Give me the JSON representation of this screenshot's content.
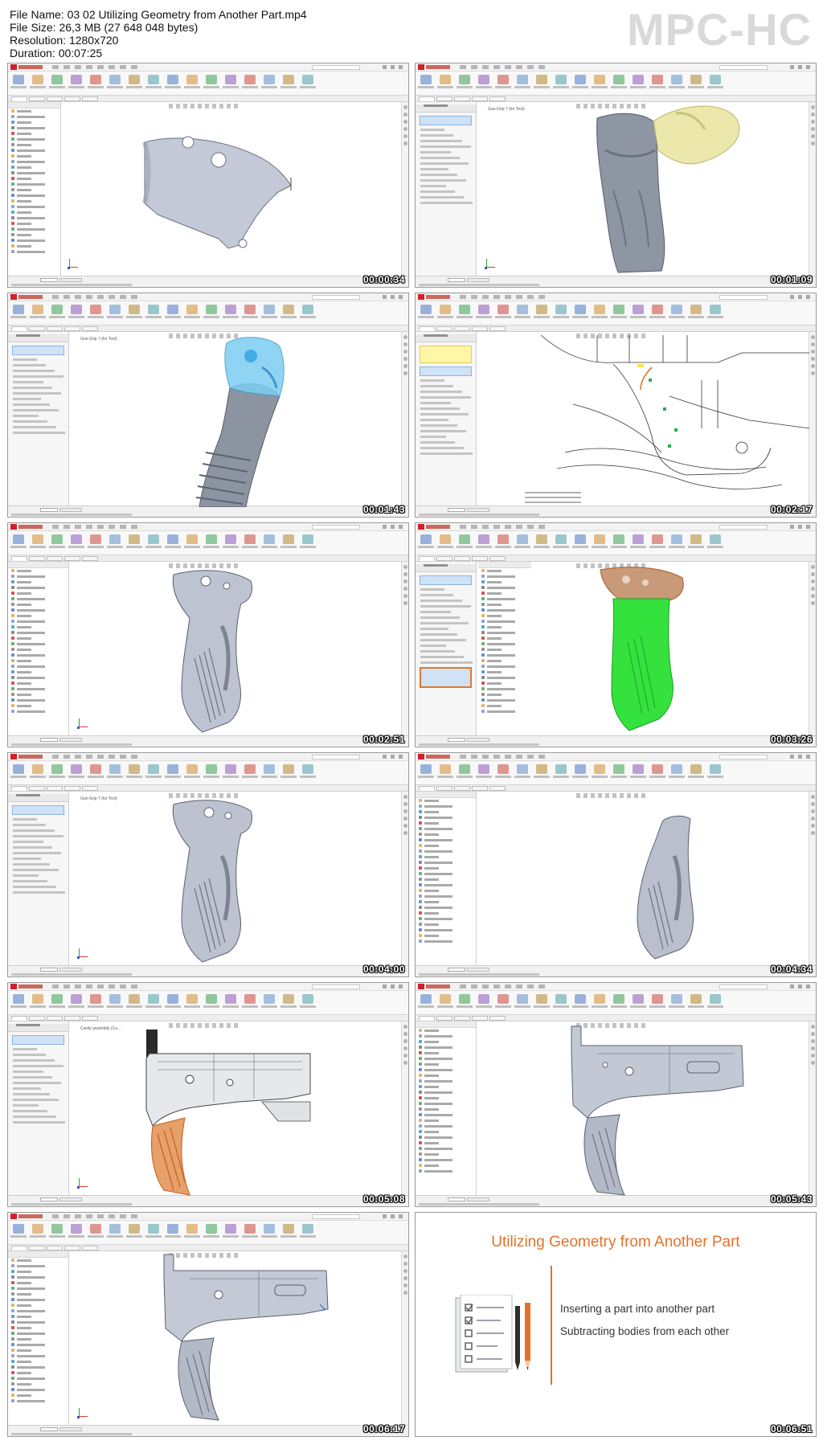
{
  "header": {
    "file_name_label": "File Name:",
    "file_name": "03 02 Utilizing Geometry from Another Part.mp4",
    "file_size_label": "File Size:",
    "file_size": "26,3 MB (27 648 048 bytes)",
    "resolution_label": "Resolution:",
    "resolution": "1280x720",
    "duration_label": "Duration:",
    "duration": "00:07:25",
    "brand": "MPC-HC"
  },
  "thumbnails": [
    {
      "timestamp": "00:00:34",
      "doc_title": ""
    },
    {
      "timestamp": "00:01:09",
      "doc_title": "Gun-Grip 7 (for Tool)"
    },
    {
      "timestamp": "00:01:43",
      "doc_title": "Gun-Grip 7 (for Tool)"
    },
    {
      "timestamp": "00:02:17",
      "doc_title": ""
    },
    {
      "timestamp": "00:02:51",
      "doc_title": ""
    },
    {
      "timestamp": "00:03:26",
      "doc_title": ""
    },
    {
      "timestamp": "00:04:00",
      "doc_title": "Gun-Grip 7 (for Tool)"
    },
    {
      "timestamp": "00:04:34",
      "doc_title": ""
    },
    {
      "timestamp": "00:05:08",
      "doc_title": "Cavity assembly (Ca..."
    },
    {
      "timestamp": "00:05:43",
      "doc_title": ""
    },
    {
      "timestamp": "00:06:17",
      "doc_title": ""
    }
  ],
  "slide": {
    "title": "Utilizing Geometry from Another Part",
    "bullets": [
      "Inserting a part into another part",
      "Subtracting bodies from each other"
    ],
    "timestamp": "00:06:51",
    "accent_color": "#e2722b"
  },
  "colors": {
    "sw_red": "#d1202c",
    "part_gray": "#b9bfcc",
    "selection_green": "#33e03a",
    "preview_blue": "#6fc8f0",
    "tool_yellow": "#e8e29a",
    "edge_orange": "#e07a2a"
  },
  "icons": [
    "solidworks-logo",
    "coordinate-triad-icon",
    "document-checklist-icon",
    "pen-icon",
    "pencil-icon"
  ]
}
